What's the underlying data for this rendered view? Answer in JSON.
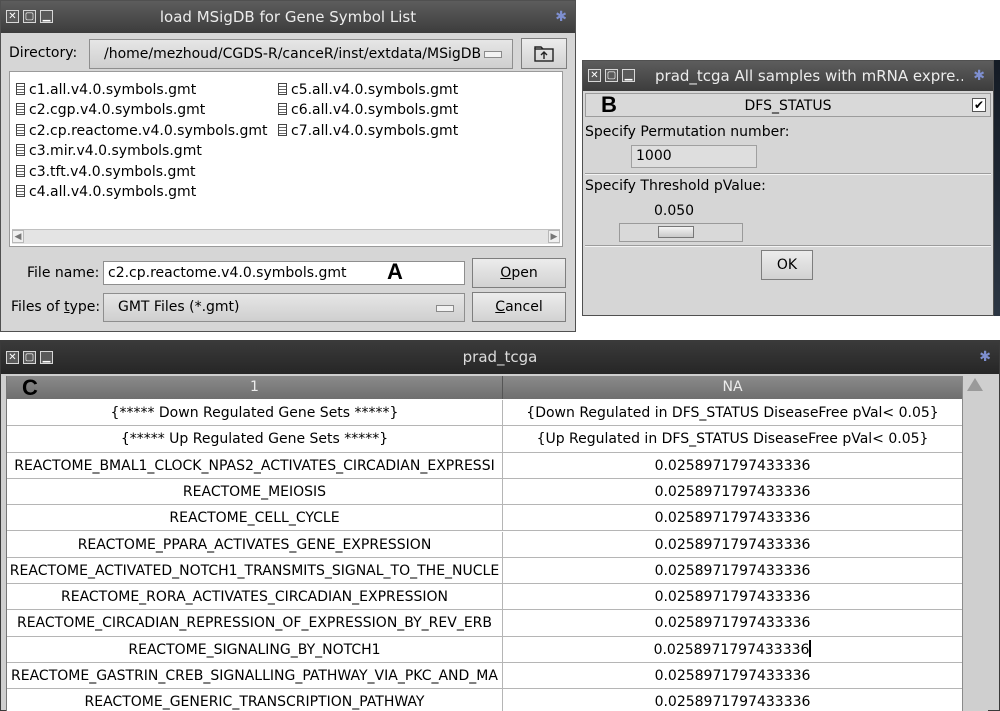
{
  "annotations": {
    "a": "A",
    "b": "B",
    "c": "C"
  },
  "dialog_a": {
    "title": "load MSigDB for Gene Symbol List",
    "directory_label": "Directory:",
    "directory_value": "/home/mezhoud/CGDS-R/canceR/inst/extdata/MSigDB",
    "up_folder_icon": "folder-up-icon",
    "files_col1": [
      "c1.all.v4.0.symbols.gmt",
      "c2.cgp.v4.0.symbols.gmt",
      "c2.cp.reactome.v4.0.symbols.gmt",
      "c3.mir.v4.0.symbols.gmt",
      "c3.tft.v4.0.symbols.gmt",
      "c4.all.v4.0.symbols.gmt"
    ],
    "files_col2": [
      "c5.all.v4.0.symbols.gmt",
      "c6.all.v4.0.symbols.gmt",
      "c7.all.v4.0.symbols.gmt"
    ],
    "file_name_label": "File name:",
    "file_name_value": "c2.cp.reactome.v4.0.symbols.gmt",
    "files_of_type_label_pre": "Files of ",
    "files_of_type_label_ul": "t",
    "files_of_type_label_post": "ype:",
    "files_of_type_value": "GMT Files (*.gmt)",
    "open_button_ul": "O",
    "open_button_rest": "pen",
    "cancel_button_ul": "C",
    "cancel_button_rest": "ancel"
  },
  "dialog_b": {
    "title": "prad_tcga All samples with mRNA expre...",
    "header_label": "DFS_STATUS",
    "header_checked": "✔",
    "permutation_label": "Specify Permutation number:",
    "permutation_value": "1000",
    "threshold_label": "Specify Threshold pValue:",
    "threshold_value": "0.050",
    "ok_button": "OK"
  },
  "table_window": {
    "title": "prad_tcga",
    "columns": [
      "1",
      "NA"
    ],
    "rows": [
      [
        "{***** Down Regulated Gene Sets *****}",
        "{Down Regulated in DFS_STATUS DiseaseFree pVal< 0.05}"
      ],
      [
        "{***** Up Regulated Gene Sets *****}",
        "{Up Regulated in DFS_STATUS DiseaseFree pVal< 0.05}"
      ],
      [
        "REACTOME_BMAL1_CLOCK_NPAS2_ACTIVATES_CIRCADIAN_EXPRESSI",
        "0.0258971797433336"
      ],
      [
        "REACTOME_MEIOSIS",
        "0.0258971797433336"
      ],
      [
        "REACTOME_CELL_CYCLE",
        "0.0258971797433336"
      ],
      [
        "REACTOME_PPARA_ACTIVATES_GENE_EXPRESSION",
        "0.0258971797433336"
      ],
      [
        "REACTOME_ACTIVATED_NOTCH1_TRANSMITS_SIGNAL_TO_THE_NUCLE",
        "0.0258971797433336"
      ],
      [
        "REACTOME_RORA_ACTIVATES_CIRCADIAN_EXPRESSION",
        "0.0258971797433336"
      ],
      [
        "REACTOME_CIRCADIAN_REPRESSION_OF_EXPRESSION_BY_REV_ERB",
        "0.0258971797433336"
      ],
      [
        "REACTOME_SIGNALING_BY_NOTCH1",
        "0.0258971797433336"
      ],
      [
        "REACTOME_GASTRIN_CREB_SIGNALLING_PATHWAY_VIA_PKC_AND_MA",
        "0.0258971797433336"
      ],
      [
        "REACTOME_GENERIC_TRANSCRIPTION_PATHWAY",
        "0.0258971797433336"
      ]
    ]
  }
}
